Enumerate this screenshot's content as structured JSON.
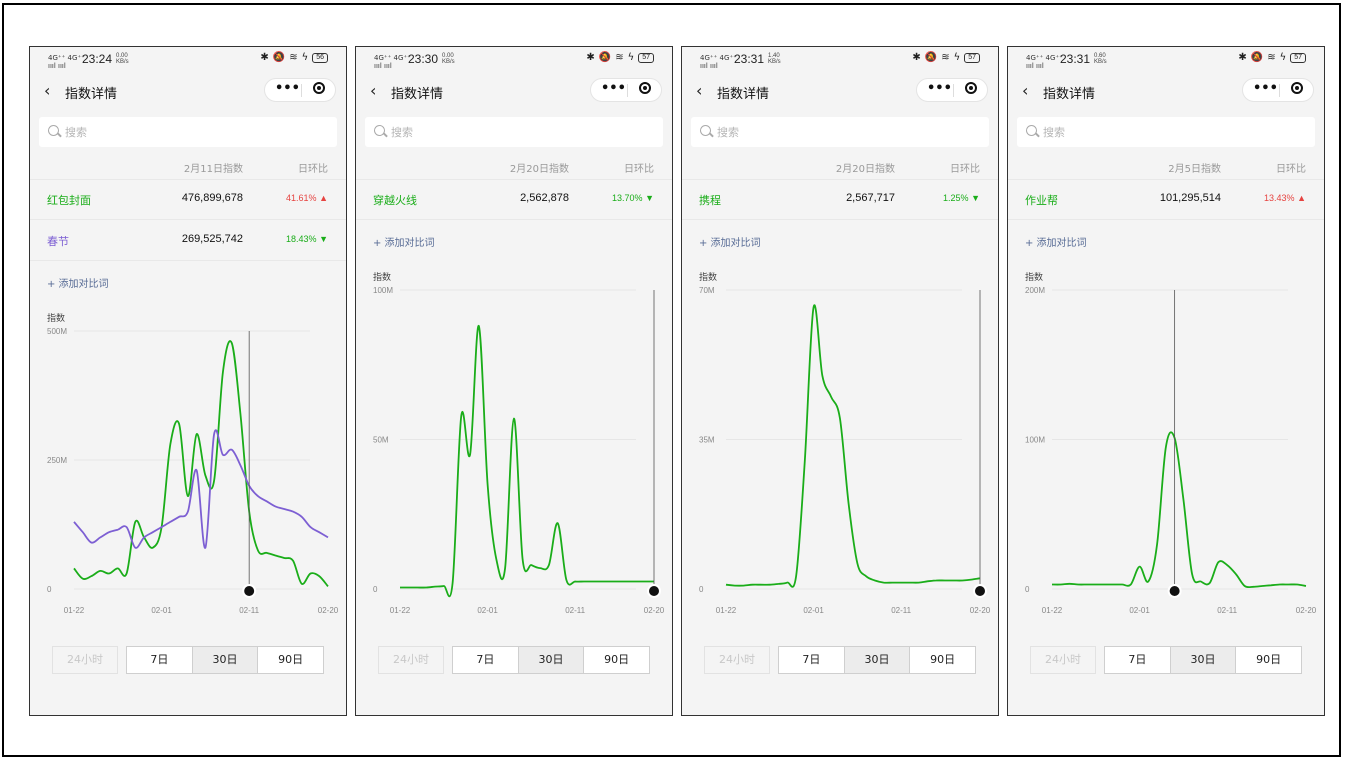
{
  "colors": {
    "green": "#1aad19",
    "purple": "#7d5fd3",
    "red": "#e64340",
    "link": "#576b95"
  },
  "common": {
    "nav_title": "指数详情",
    "search_placeholder": "搜索",
    "ratio_header": "日环比",
    "add_compare": "+ 添加对比词",
    "y_axis_title": "指数",
    "tabs": [
      "24小时",
      "7日",
      "30日",
      "90日"
    ],
    "selected_tab": "30日"
  },
  "phones": [
    {
      "status": {
        "time": "23:24",
        "speed": "0.00",
        "speed_unit": "KB/s",
        "battery": "56"
      },
      "date_header": "2月11日指数",
      "rows": [
        {
          "name": "红包封面",
          "value": "476,899,678",
          "pct": "41.61%",
          "dir": "up",
          "color": "green"
        },
        {
          "name": "春节",
          "value": "269,525,742",
          "pct": "18.43%",
          "dir": "down",
          "color": "purple"
        }
      ],
      "chart_data": {
        "type": "line",
        "y_ticks": [
          "500M",
          "250M",
          "0"
        ],
        "ylim": [
          0,
          500000000
        ],
        "x_ticks": [
          "01-22",
          "02-01",
          "02-11",
          "02-20"
        ],
        "x_tick_dates": [
          1,
          11,
          21,
          30
        ],
        "cursor_date": 21,
        "series": [
          {
            "name": "红包封面",
            "color": "green",
            "x": [
              1,
              2,
              3,
              4,
              5,
              6,
              7,
              8,
              9,
              10,
              11,
              12,
              13,
              14,
              15,
              16,
              17,
              18,
              19,
              20,
              21,
              22,
              23,
              24,
              25,
              26,
              27,
              28,
              29,
              30
            ],
            "values": [
              40000000,
              20000000,
              25000000,
              35000000,
              30000000,
              40000000,
              30000000,
              130000000,
              100000000,
              80000000,
              120000000,
              280000000,
              320000000,
              180000000,
              300000000,
              220000000,
              210000000,
              420000000,
              477000000,
              340000000,
              150000000,
              75000000,
              70000000,
              65000000,
              60000000,
              55000000,
              10000000,
              30000000,
              25000000,
              5000000
            ]
          },
          {
            "name": "春节",
            "color": "purple",
            "x": [
              1,
              2,
              3,
              4,
              5,
              6,
              7,
              8,
              9,
              10,
              11,
              12,
              13,
              14,
              15,
              16,
              17,
              18,
              19,
              20,
              21,
              22,
              23,
              24,
              25,
              26,
              27,
              28,
              29,
              30
            ],
            "values": [
              130000000,
              110000000,
              90000000,
              100000000,
              110000000,
              115000000,
              120000000,
              80000000,
              100000000,
              110000000,
              120000000,
              130000000,
              140000000,
              150000000,
              230000000,
              80000000,
              300000000,
              260000000,
              270000000,
              240000000,
              200000000,
              180000000,
              170000000,
              160000000,
              155000000,
              150000000,
              140000000,
              120000000,
              110000000,
              100000000
            ]
          }
        ]
      }
    },
    {
      "status": {
        "time": "23:30",
        "speed": "0.00",
        "speed_unit": "KB/s",
        "battery": "57"
      },
      "date_header": "2月20日指数",
      "rows": [
        {
          "name": "穿越火线",
          "value": "2,562,878",
          "pct": "13.70%",
          "dir": "down",
          "color": "green"
        }
      ],
      "chart_data": {
        "type": "line",
        "y_ticks": [
          "100M",
          "50M",
          "0"
        ],
        "ylim": [
          0,
          100000000
        ],
        "x_ticks": [
          "01-22",
          "02-01",
          "02-11",
          "02-20"
        ],
        "x_tick_dates": [
          1,
          11,
          21,
          30
        ],
        "cursor_date": 30,
        "series": [
          {
            "name": "穿越火线",
            "color": "green",
            "x": [
              1,
              2,
              3,
              4,
              5,
              6,
              7,
              8,
              9,
              10,
              11,
              12,
              13,
              14,
              15,
              16,
              17,
              18,
              19,
              20,
              21,
              22,
              23,
              24,
              25,
              26,
              27,
              28,
              29,
              30
            ],
            "values": [
              500000,
              500000,
              500000,
              500000,
              800000,
              1000000,
              2000000,
              58000000,
              45000000,
              88000000,
              35000000,
              10000000,
              7000000,
              57000000,
              10000000,
              8000000,
              7000000,
              8000000,
              22000000,
              3000000,
              2500000,
              2500000,
              2500000,
              2500000,
              2500000,
              2500000,
              2500000,
              2500000,
              2500000,
              2500000
            ]
          }
        ]
      }
    },
    {
      "status": {
        "time": "23:31",
        "speed": "1.40",
        "speed_unit": "KB/s",
        "battery": "57"
      },
      "date_header": "2月20日指数",
      "rows": [
        {
          "name": "携程",
          "value": "2,567,717",
          "pct": "1.25%",
          "dir": "down",
          "color": "green"
        }
      ],
      "chart_data": {
        "type": "line",
        "y_ticks": [
          "70M",
          "35M",
          "0"
        ],
        "ylim": [
          0,
          70000000
        ],
        "x_ticks": [
          "01-22",
          "02-01",
          "02-11",
          "02-20"
        ],
        "x_tick_dates": [
          1,
          11,
          21,
          30
        ],
        "cursor_date": 30,
        "series": [
          {
            "name": "携程",
            "color": "green",
            "x": [
              1,
              2,
              3,
              4,
              5,
              6,
              7,
              8,
              9,
              10,
              11,
              12,
              13,
              14,
              15,
              16,
              17,
              18,
              19,
              20,
              21,
              22,
              23,
              24,
              25,
              26,
              27,
              28,
              29,
              30
            ],
            "values": [
              1000000,
              800000,
              800000,
              1000000,
              1000000,
              1000000,
              1200000,
              1500000,
              3000000,
              30000000,
              66000000,
              50000000,
              45000000,
              40000000,
              20000000,
              6000000,
              3000000,
              2000000,
              1500000,
              1500000,
              1500000,
              1500000,
              1500000,
              1800000,
              2000000,
              2000000,
              2000000,
              2000000,
              2200000,
              2500000
            ]
          }
        ]
      }
    },
    {
      "status": {
        "time": "23:31",
        "speed": "0.60",
        "speed_unit": "KB/s",
        "battery": "57"
      },
      "date_header": "2月5日指数",
      "rows": [
        {
          "name": "作业帮",
          "value": "101,295,514",
          "pct": "13.43%",
          "dir": "up",
          "color": "green"
        }
      ],
      "chart_data": {
        "type": "line",
        "y_ticks": [
          "200M",
          "100M",
          "0"
        ],
        "ylim": [
          0,
          200000000
        ],
        "x_ticks": [
          "01-22",
          "02-01",
          "02-11",
          "02-20"
        ],
        "x_tick_dates": [
          1,
          11,
          21,
          30
        ],
        "cursor_date": 15,
        "series": [
          {
            "name": "作业帮",
            "color": "green",
            "x": [
              1,
              2,
              3,
              4,
              5,
              6,
              7,
              8,
              9,
              10,
              11,
              12,
              13,
              14,
              15,
              16,
              17,
              18,
              19,
              20,
              21,
              22,
              23,
              24,
              25,
              26,
              27,
              28,
              29,
              30
            ],
            "values": [
              3000000,
              3000000,
              3500000,
              3000000,
              3000000,
              3000000,
              3000000,
              3000000,
              3000000,
              3000000,
              15000000,
              5000000,
              30000000,
              95000000,
              101000000,
              60000000,
              10000000,
              5000000,
              4000000,
              18000000,
              16000000,
              10000000,
              2000000,
              1500000,
              2000000,
              2500000,
              3000000,
              3000000,
              3000000,
              2000000
            ]
          }
        ]
      }
    }
  ]
}
